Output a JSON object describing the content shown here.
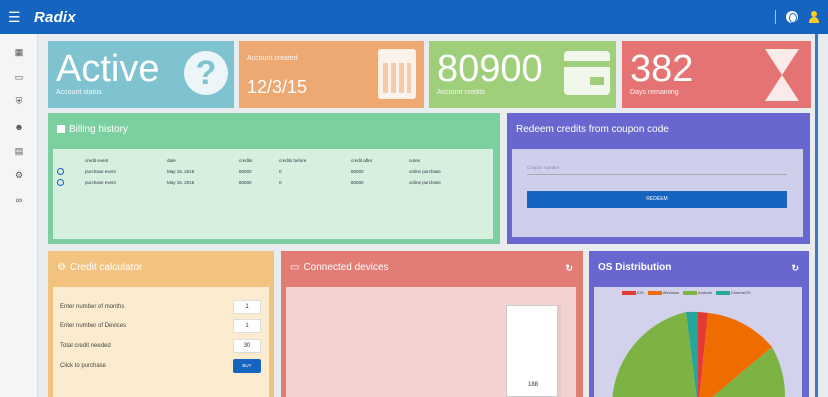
{
  "app": {
    "brand": "Radix"
  },
  "tiles": [
    {
      "value": "Active",
      "label": "Account status",
      "color": "#7ec3cf",
      "icon": "question-icon"
    },
    {
      "value": "12/3/15",
      "label": "Account created",
      "color": "#eda971",
      "icon": "calendar-icon"
    },
    {
      "value": "80900",
      "label": "Account credits",
      "color": "#9fcf7a",
      "icon": "credit-card-icon"
    },
    {
      "value": "382",
      "label": "Days remaining",
      "color": "#e57373",
      "icon": "hourglass-icon"
    }
  ],
  "billing": {
    "title": "Billing history",
    "columns": [
      "credit event",
      "date",
      "credits",
      "credits before",
      "credit after",
      "notes"
    ],
    "rows": [
      {
        "event": "purchase event",
        "date": "May 15, 2016",
        "credits": "80000",
        "before": "0",
        "after": "80000",
        "notes": "online purchase"
      },
      {
        "event": "purchase event",
        "date": "May 15, 2016",
        "credits": "80000",
        "before": "0",
        "after": "80000",
        "notes": "online purchase"
      }
    ]
  },
  "redeem": {
    "title": "Redeem credits from coupon code",
    "placeholder": "Coupon number",
    "button": "REDEEM"
  },
  "calculator": {
    "title": "Credit calculator",
    "months_label": "Enter number of months",
    "months_value": "1",
    "devices_label": "Enter number of Devices",
    "devices_value": "1",
    "total_label": "Total credit needed",
    "total_value": "30",
    "purchase_label": "Click to purchase",
    "buy_button": "BUY"
  },
  "devices": {
    "title": "Connected devices",
    "bar_value": "188"
  },
  "os": {
    "title": "OS Distribution",
    "legend": [
      {
        "name": "iOS",
        "color": "#e53935"
      },
      {
        "name": "Windows",
        "color": "#ef6c00"
      },
      {
        "name": "Android",
        "color": "#7cb342"
      },
      {
        "name": "ChromeOS",
        "color": "#26a69a"
      }
    ]
  }
}
